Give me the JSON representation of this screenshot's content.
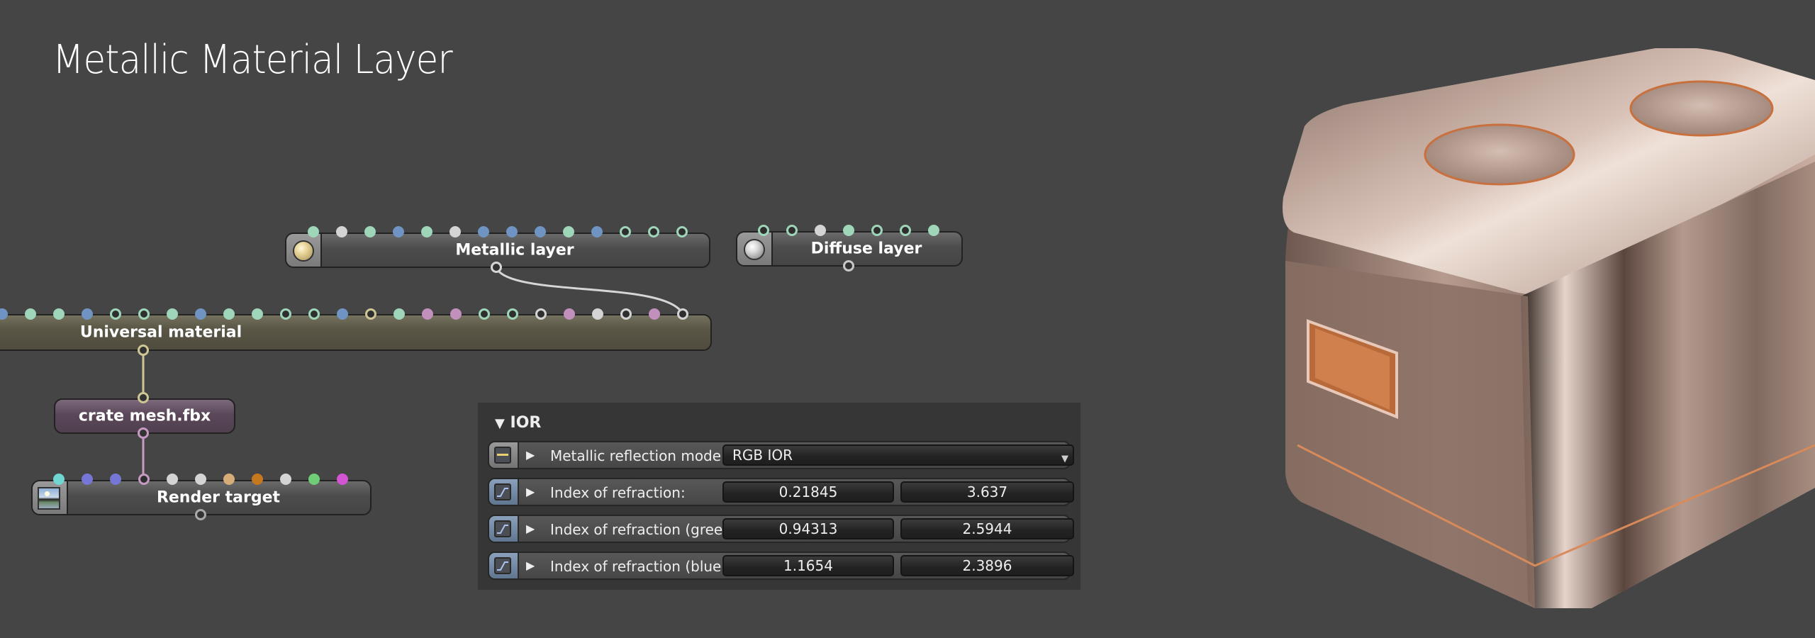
{
  "page": {
    "title": "Metallic Material Layer"
  },
  "colors": {
    "background": "#454545",
    "pin_green": "#9fd6b9",
    "pin_blue": "#6f94c4",
    "pin_white": "#d4d4d4",
    "pin_pink": "#c190bd",
    "pin_yellow": "#cfc695",
    "wire_yellow": "#cfc695",
    "wire_pink": "#c79ac4",
    "wire_white": "#d6d6d6"
  },
  "nodes": {
    "metallic_layer": {
      "label": "Metallic layer",
      "icon": "gold-sphere-icon"
    },
    "diffuse_layer": {
      "label": "Diffuse layer",
      "icon": "silver-sphere-icon"
    },
    "universal_material": {
      "label": "Universal material"
    },
    "crate_mesh": {
      "label": "crate mesh.fbx"
    },
    "render_target": {
      "label": "Render target",
      "icon": "image-icon"
    }
  },
  "pins": {
    "metallic_layer": [
      {
        "color": "green",
        "open": false
      },
      {
        "color": "white",
        "open": false
      },
      {
        "color": "green",
        "open": false
      },
      {
        "color": "blue",
        "open": false
      },
      {
        "color": "green",
        "open": false
      },
      {
        "color": "white",
        "open": false
      },
      {
        "color": "blue",
        "open": false
      },
      {
        "color": "blue",
        "open": false
      },
      {
        "color": "blue",
        "open": false
      },
      {
        "color": "green",
        "open": false
      },
      {
        "color": "blue",
        "open": false
      },
      {
        "color": "green",
        "open": true
      },
      {
        "color": "green",
        "open": true
      },
      {
        "color": "green",
        "open": true
      }
    ],
    "diffuse_layer": [
      {
        "color": "green",
        "open": true
      },
      {
        "color": "green",
        "open": true
      },
      {
        "color": "white",
        "open": false
      },
      {
        "color": "green",
        "open": false
      },
      {
        "color": "green",
        "open": true
      },
      {
        "color": "green",
        "open": true
      },
      {
        "color": "green",
        "open": false
      }
    ],
    "universal_material": [
      {
        "color": "blue",
        "open": false
      },
      {
        "color": "green",
        "open": false
      },
      {
        "color": "green",
        "open": false
      },
      {
        "color": "blue",
        "open": false
      },
      {
        "color": "green",
        "open": true
      },
      {
        "color": "green",
        "open": true
      },
      {
        "color": "green",
        "open": false
      },
      {
        "color": "blue",
        "open": false
      },
      {
        "color": "green",
        "open": false
      },
      {
        "color": "green",
        "open": false
      },
      {
        "color": "green",
        "open": true
      },
      {
        "color": "green",
        "open": true
      },
      {
        "color": "blue",
        "open": false
      },
      {
        "color": "yellow",
        "open": true
      },
      {
        "color": "green",
        "open": false
      },
      {
        "color": "pink",
        "open": false
      },
      {
        "color": "pink",
        "open": false
      },
      {
        "color": "green",
        "open": true
      },
      {
        "color": "green",
        "open": true
      },
      {
        "color": "white",
        "open": true
      },
      {
        "color": "pink",
        "open": false
      },
      {
        "color": "white",
        "open": false
      },
      {
        "color": "white",
        "open": true
      },
      {
        "color": "pink",
        "open": false
      },
      {
        "color": "white",
        "open": true
      }
    ],
    "render_target": [
      {
        "color": "#6fd6d2",
        "open": false
      },
      {
        "color": "#7676d6",
        "open": false
      },
      {
        "color": "#7676d6",
        "open": false
      },
      {
        "color": "#c79ac4",
        "open": true
      },
      {
        "color": "#d4d4d4",
        "open": false
      },
      {
        "color": "#d4d4d4",
        "open": false
      },
      {
        "color": "#d6ad78",
        "open": false
      },
      {
        "color": "#c5781e",
        "open": false
      },
      {
        "color": "#d4d4d4",
        "open": false
      },
      {
        "color": "#6fcd78",
        "open": false
      },
      {
        "color": "#d455d4",
        "open": false
      }
    ]
  },
  "ior_panel": {
    "section_title": "IOR",
    "rows": [
      {
        "label": "Metallic reflection mode:",
        "type": "dropdown",
        "value": "RGB IOR",
        "icon": "enum-icon"
      },
      {
        "label": "Index of refraction:",
        "type": "pair",
        "values": [
          "0.21845",
          "3.637"
        ],
        "icon": "curve-icon"
      },
      {
        "label": "Index of refraction (green):",
        "type": "pair",
        "values": [
          "0.94313",
          "2.5944"
        ],
        "icon": "curve-icon"
      },
      {
        "label": "Index of refraction (blue):",
        "type": "pair",
        "values": [
          "1.1654",
          "2.3896"
        ],
        "icon": "curve-icon"
      }
    ]
  },
  "glyphs": {
    "collapse": "▼",
    "expand": "▶",
    "dropdown": "▼"
  },
  "preview": {
    "description": "Rendered copper metallic crate"
  }
}
